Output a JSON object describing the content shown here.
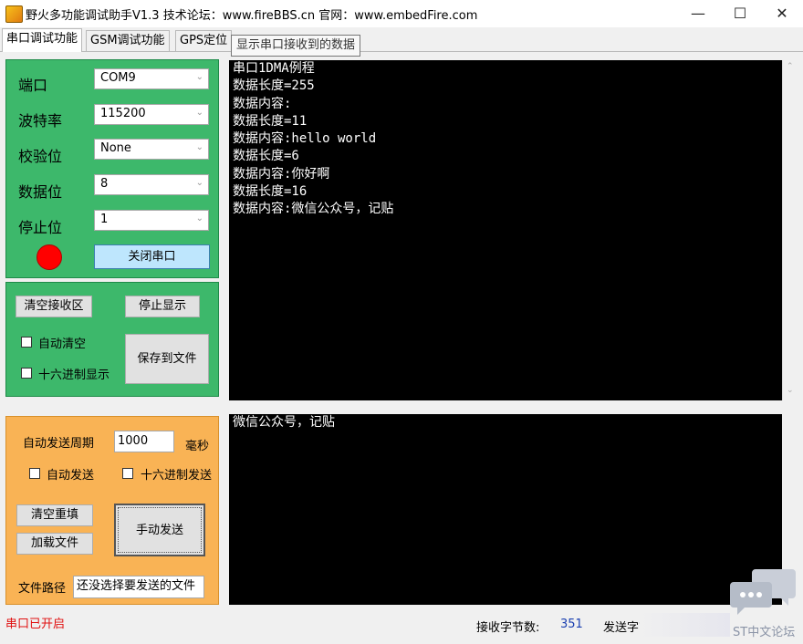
{
  "window": {
    "title": "野火多功能调试助手V1.3    技术论坛：www.fireBBS.cn    官网：www.embedFire.com",
    "minimize_glyph": "—",
    "maximize_glyph": "☐",
    "close_glyph": "✕"
  },
  "tabs": [
    {
      "label": "串口调试功能"
    },
    {
      "label": "GSM调试功能"
    },
    {
      "label": "GPS定位"
    }
  ],
  "tooltip": "显示串口接收到的数据",
  "serial": {
    "port_label": "端口",
    "port_value": "COM9",
    "baud_label": "波特率",
    "baud_value": "115200",
    "parity_label": "校验位",
    "parity_value": "None",
    "databits_label": "数据位",
    "databits_value": "8",
    "stopbits_label": "停止位",
    "stopbits_value": "1",
    "close_button": "关闭串口",
    "status_color": "#ff0000"
  },
  "display": {
    "clear_button": "清空接收区",
    "stop_button": "停止显示",
    "auto_clear_label": "自动清空",
    "hex_display_label": "十六进制显示",
    "save_button": "保存到文件"
  },
  "send": {
    "period_label": "自动发送周期",
    "period_value": "1000",
    "period_unit": "毫秒",
    "auto_send_label": "自动发送",
    "hex_send_label": "十六进制发送",
    "clear_fill_button": "清空重填",
    "load_file_button": "加载文件",
    "manual_send_button": "手动发送",
    "file_path_label": "文件路径",
    "file_path_value": "还没选择要发送的文件"
  },
  "receive_text": "串口1DMA例程\n数据长度=255\n数据内容:\n数据长度=11\n数据内容:hello world\n数据长度=6\n数据内容:你好啊\n数据长度=16\n数据内容:微信公众号，记贴",
  "send_text": "微信公众号，记贴",
  "statusbar": {
    "port_status": "串口已开启",
    "rx_label": "接收字节数:",
    "rx_value": "351",
    "tx_label": "发送字节数:",
    "watermark": "ST中文论坛"
  },
  "colors": {
    "green_panel": "#3db86b",
    "orange_panel": "#f9b355",
    "terminal_bg": "#000000",
    "status_red": "#e01010",
    "rx_value_color": "#1a3fb0"
  }
}
